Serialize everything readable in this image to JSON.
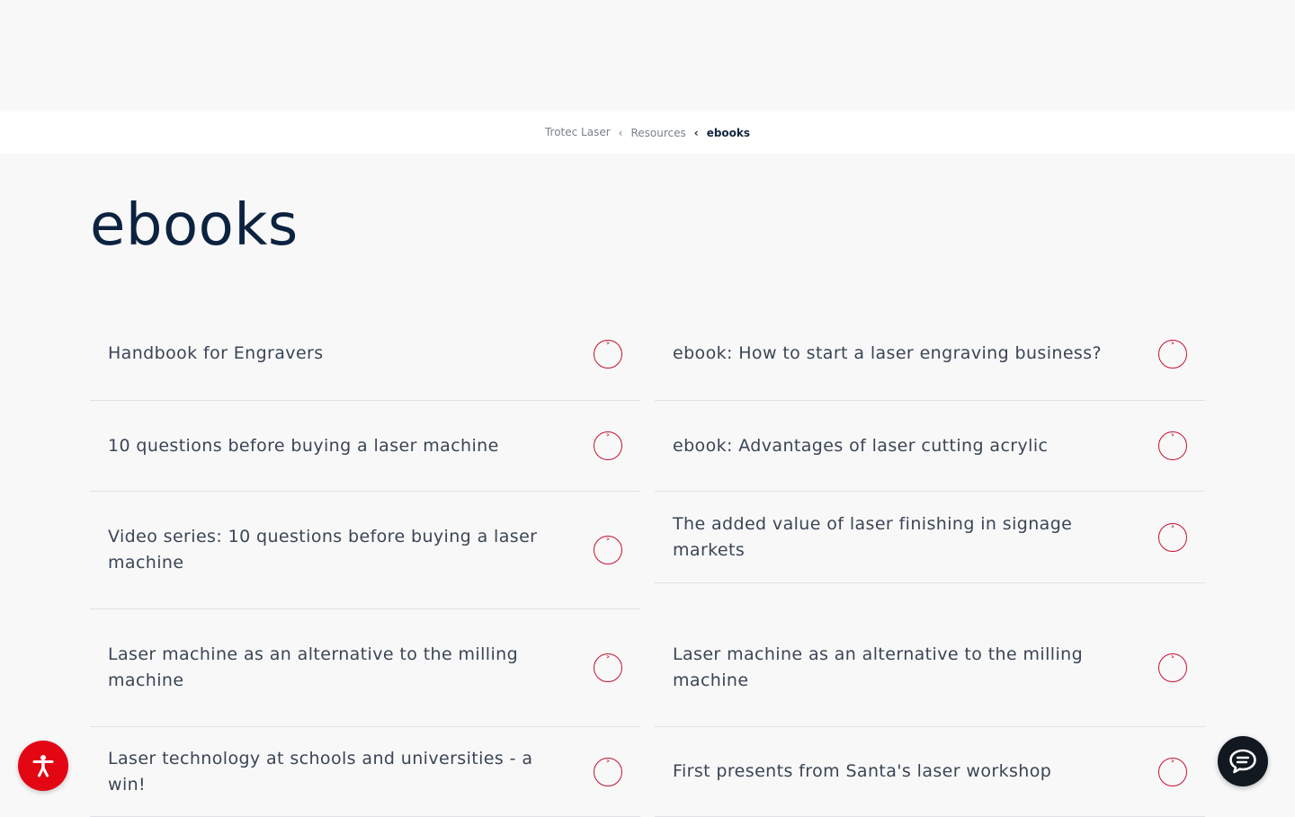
{
  "breadcrumb": {
    "items": [
      "Trotec Laser",
      "Resources"
    ],
    "separator": "‹",
    "current": "ebooks"
  },
  "page": {
    "title": "ebooks"
  },
  "cards_left": [
    "Handbook for Engravers",
    "10 questions before buying a laser machine",
    "Video series: 10 questions before buying a laser machine",
    "Laser machine as an alternative to the milling machine",
    "Laser technology at schools and universities - a win!"
  ],
  "cards_right": [
    "ebook: How to start a laser engraving business?",
    "ebook: Advantages of laser cutting acrylic",
    "The added value of laser finishing in signage markets",
    "Laser machine as an alternative to the milling machine",
    "First presents from Santa's laser workshop"
  ],
  "card_arrow_glyph": "˃",
  "icons": {
    "card_arrow": "chevron-right-icon",
    "accessibility": "accessibility-icon",
    "chat": "chat-icon"
  },
  "colors": {
    "accent": "#c8102e",
    "title": "#0c2340",
    "accessibility_bg": "#e30613",
    "chat_bg": "#121820"
  }
}
